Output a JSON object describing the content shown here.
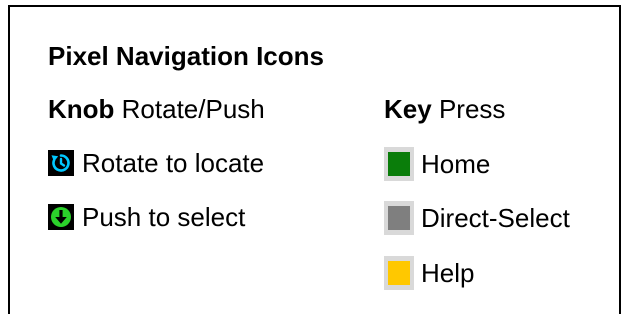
{
  "title": "Pixel Navigation Icons",
  "knob": {
    "heading_bold": "Knob",
    "heading_rest": "Rotate/Push",
    "items": [
      {
        "label": "Rotate to locate",
        "icon": "rotate-icon",
        "color": "#00c8ff"
      },
      {
        "label": "Push to select",
        "icon": "push-icon",
        "color": "#2bd22b"
      }
    ]
  },
  "key": {
    "heading_bold": "Key",
    "heading_rest": "Press",
    "items": [
      {
        "label": "Home",
        "color": "#0a7d0a"
      },
      {
        "label": "Direct-Select",
        "color": "#7f7f7f"
      },
      {
        "label": "Help",
        "color": "#ffc800"
      }
    ]
  }
}
